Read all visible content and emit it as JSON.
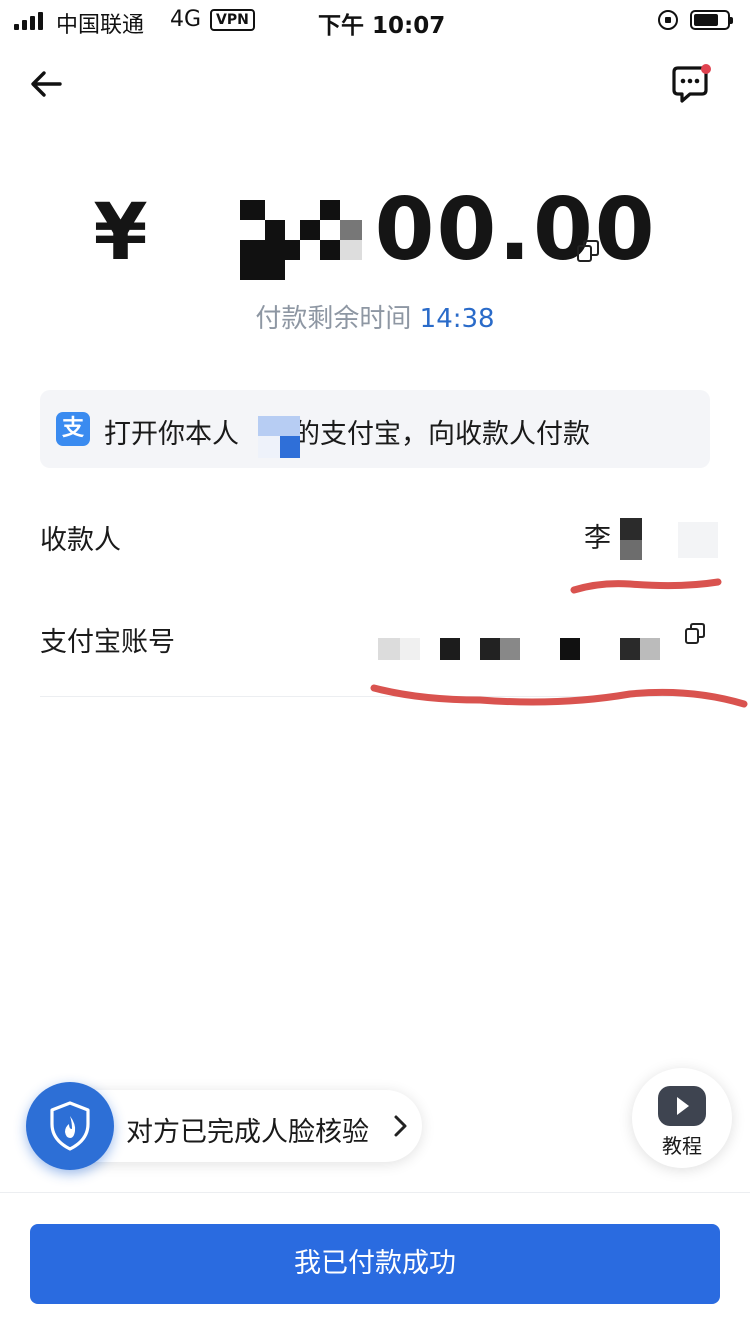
{
  "status_bar": {
    "carrier": "中国联通",
    "network": "4G",
    "vpn_label": "VPN",
    "time": "下午 10:07"
  },
  "nav": {
    "back_icon": "arrow-left-icon",
    "message_icon": "chat-bubble-icon"
  },
  "payment": {
    "currency_symbol": "¥",
    "amount_visible_part": "00.00",
    "timer_label": "付款剩余时间",
    "timer_value": "14:38"
  },
  "notice": {
    "badge": "支",
    "text_before": "打开你本人",
    "text_after": "的支付宝，向收款人付款"
  },
  "payee": {
    "label": "收款人",
    "value_visible": "李"
  },
  "account": {
    "label": "支付宝账号"
  },
  "face_verify": {
    "text": "对方已完成人脸核验"
  },
  "tutorial": {
    "label": "教程"
  },
  "actions": {
    "paid_button": "我已付款成功"
  },
  "colors": {
    "primary": "#2a6be0",
    "timer_value": "#2a6bc9",
    "alipay_blue": "#3a8bf0",
    "annotation_red": "#d9534f"
  }
}
